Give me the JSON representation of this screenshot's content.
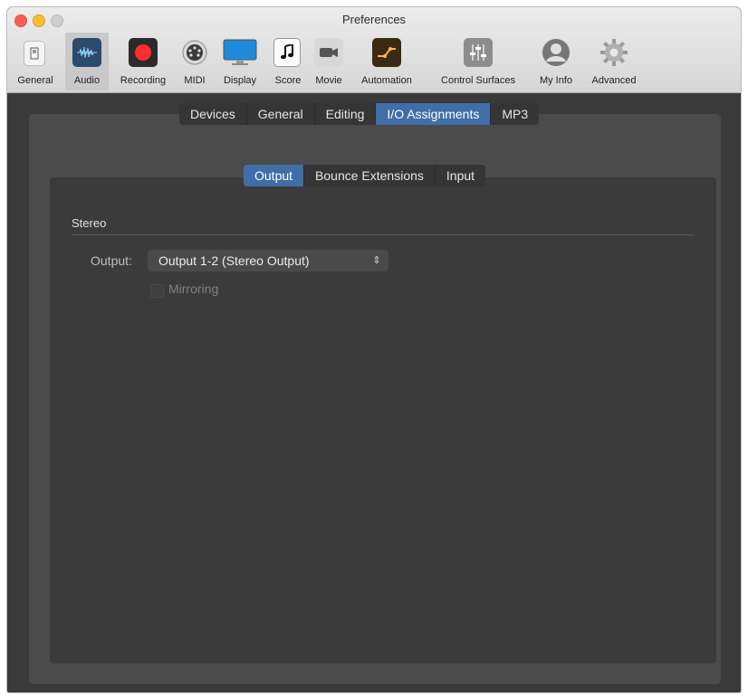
{
  "window": {
    "title": "Preferences"
  },
  "toolbar": {
    "items": [
      {
        "label": "General",
        "icon": "switch-icon"
      },
      {
        "label": "Audio",
        "icon": "waveform-icon"
      },
      {
        "label": "Recording",
        "icon": "record-icon"
      },
      {
        "label": "MIDI",
        "icon": "midi-plug-icon"
      },
      {
        "label": "Display",
        "icon": "monitor-icon"
      },
      {
        "label": "Score",
        "icon": "music-note-icon"
      },
      {
        "label": "Movie",
        "icon": "video-camera-icon"
      },
      {
        "label": "Automation",
        "icon": "automation-curve-icon"
      },
      {
        "label": "Control Surfaces",
        "icon": "mixer-faders-icon"
      },
      {
        "label": "My Info",
        "icon": "person-icon"
      },
      {
        "label": "Advanced",
        "icon": "gear-icon"
      }
    ],
    "selected": "Audio"
  },
  "main_tabs": {
    "items": [
      "Devices",
      "General",
      "Editing",
      "I/O Assignments",
      "MP3"
    ],
    "active": "I/O Assignments"
  },
  "sub_tabs": {
    "items": [
      "Output",
      "Bounce Extensions",
      "Input"
    ],
    "active": "Output"
  },
  "stereo": {
    "heading": "Stereo",
    "output_label": "Output:",
    "output_value": "Output 1-2 (Stereo Output)",
    "mirroring_label": "Mirroring",
    "mirroring_checked": false,
    "mirroring_enabled": false
  },
  "colors": {
    "accent": "#3f6ea8",
    "record_red": "#ff2d2d",
    "close": "#fc5f57",
    "minimize": "#fdbc2f"
  }
}
